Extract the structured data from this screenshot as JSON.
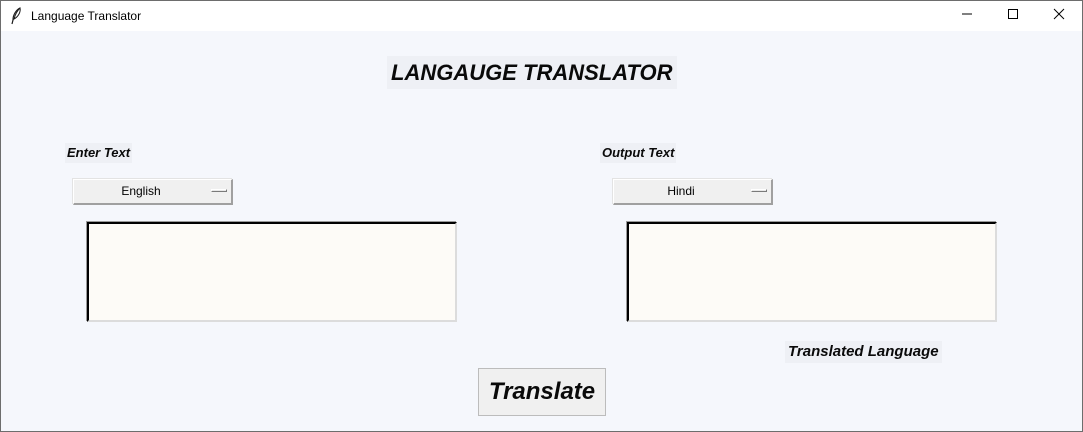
{
  "window": {
    "title": "Language Translator",
    "app_icon": "feather-icon",
    "controls": {
      "minimize_icon": "minimize-icon",
      "maximize_icon": "maximize-icon",
      "close_icon": "close-icon"
    }
  },
  "main": {
    "heading": "LANGAUGE TRANSLATOR",
    "input_label": "Enter Text",
    "output_label": "Output Text",
    "source_language": "English",
    "target_language": "Hindi",
    "input_text": "",
    "output_text": "",
    "translated_language_label": "Translated Language",
    "translate_button": "Translate"
  },
  "colors": {
    "window_background": "#f5f7fc",
    "label_background": "#eef0f5",
    "textbox_background": "#fdfbf7",
    "button_background": "#f0f0f0"
  }
}
